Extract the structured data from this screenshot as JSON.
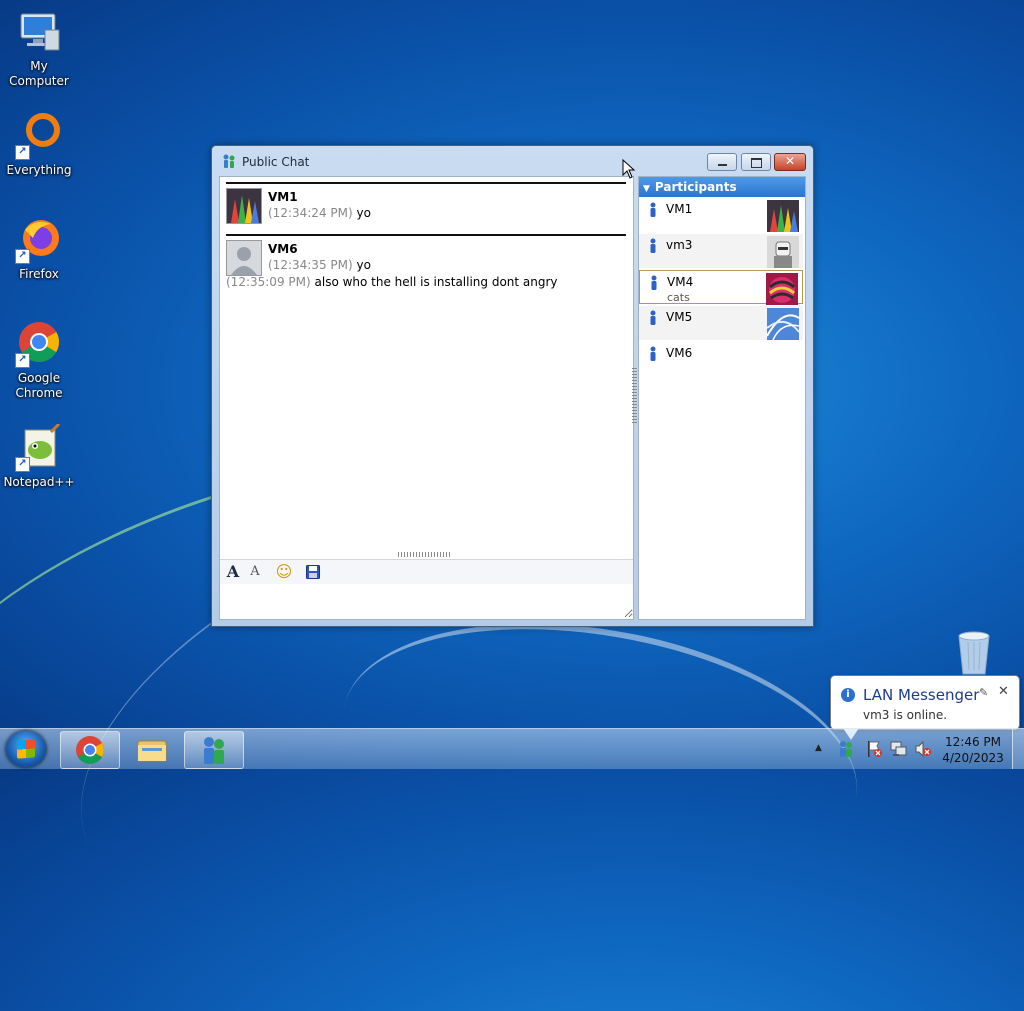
{
  "desktop": {
    "icons": [
      {
        "label": "My Computer"
      },
      {
        "label": "Everything"
      },
      {
        "label": "Firefox"
      },
      {
        "label": "Google Chrome"
      },
      {
        "label": "Notepad++"
      }
    ]
  },
  "window": {
    "title": "Public Chat",
    "close_glyph": "✕",
    "messages": [
      {
        "sender": "VM1",
        "time": "(12:34:24 PM)",
        "text": "yo"
      },
      {
        "sender": "VM6",
        "time": "(12:34:35 PM)",
        "text": "yo"
      }
    ],
    "extra_message": {
      "time": "(12:35:09 PM)",
      "text": "also who the hell is installing dont angry"
    },
    "toolbar": {
      "font_glyph": "A",
      "color_glyph": "A",
      "emoticon_glyph": "☺"
    },
    "participants": {
      "header": "Participants",
      "items": [
        {
          "name": "VM1",
          "note": ""
        },
        {
          "name": "vm3",
          "note": ""
        },
        {
          "name": "VM4",
          "note": "cats"
        },
        {
          "name": "VM5",
          "note": ""
        },
        {
          "name": "VM6",
          "note": ""
        }
      ]
    }
  },
  "notification": {
    "title": "LAN Messenger",
    "message": "vm3 is online.",
    "close_glyph": "✕"
  },
  "taskbar": {
    "time": "12:46 PM",
    "date": "4/20/2023",
    "tray_up_glyph": "▲"
  },
  "colors": {
    "accent": "#2a74cf",
    "title_text": "#1c2a3a",
    "timestamp": "#888888"
  }
}
